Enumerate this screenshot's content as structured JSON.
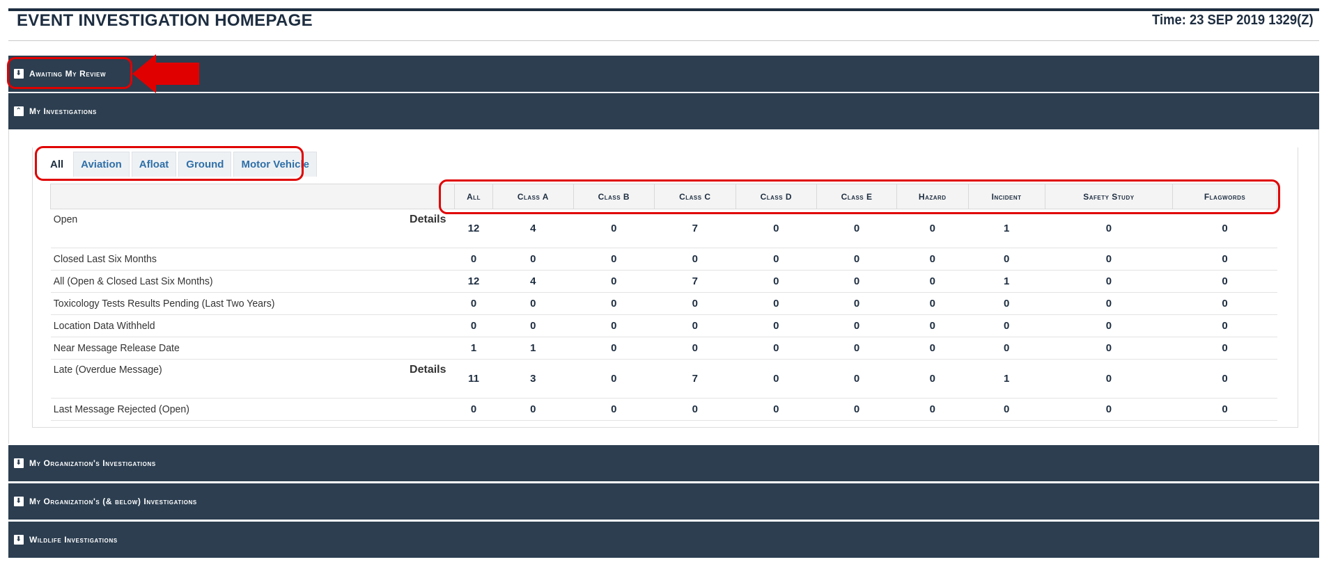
{
  "header": {
    "title": "EVENT INVESTIGATION HOMEPAGE",
    "time": "Time: 23 SEP 2019 1329(Z)"
  },
  "sections": {
    "awaiting_review": {
      "label": "Awaiting My Review",
      "icon": "down-arrow-icon",
      "toggle": "⬇"
    },
    "my_investigations": {
      "label": "My Investigations",
      "icon": "up-caret-icon",
      "toggle": "⌃"
    },
    "org_investigations": {
      "label": "My Organization's Investigations",
      "icon": "down-arrow-icon",
      "toggle": "⬇"
    },
    "org_below_investigations": {
      "label": "My Organization's (& below) Investigations",
      "icon": "down-arrow-icon",
      "toggle": "⬇"
    },
    "wildlife_investigations": {
      "label": "Wildlife Investigations",
      "icon": "down-arrow-icon",
      "toggle": "⬇"
    }
  },
  "tabs": [
    "All",
    "Aviation",
    "Afloat",
    "Ground",
    "Motor Vehicle"
  ],
  "active_tab": "All",
  "table": {
    "columns": [
      "All",
      "Class A",
      "Class B",
      "Class C",
      "Class D",
      "Class E",
      "Hazard",
      "Incident",
      "Safety Study",
      "Flagwords"
    ],
    "rows": [
      {
        "label": "Open",
        "details": "Details",
        "values": [
          "12",
          "4",
          "0",
          "7",
          "0",
          "0",
          "0",
          "1",
          "0",
          "0"
        ]
      },
      {
        "label": "Closed Last Six Months",
        "details": "",
        "values": [
          "0",
          "0",
          "0",
          "0",
          "0",
          "0",
          "0",
          "0",
          "0",
          "0"
        ]
      },
      {
        "label": "All (Open & Closed Last Six Months)",
        "details": "",
        "values": [
          "12",
          "4",
          "0",
          "7",
          "0",
          "0",
          "0",
          "1",
          "0",
          "0"
        ]
      },
      {
        "label": "Toxicology Tests Results Pending (Last Two Years)",
        "details": "",
        "values": [
          "0",
          "0",
          "0",
          "0",
          "0",
          "0",
          "0",
          "0",
          "0",
          "0"
        ]
      },
      {
        "label": "Location Data Withheld",
        "details": "",
        "values": [
          "0",
          "0",
          "0",
          "0",
          "0",
          "0",
          "0",
          "0",
          "0",
          "0"
        ]
      },
      {
        "label": "Near Message Release Date",
        "details": "",
        "values": [
          "1",
          "1",
          "0",
          "0",
          "0",
          "0",
          "0",
          "0",
          "0",
          "0"
        ]
      },
      {
        "label": "Late (Overdue Message)",
        "details": "Details",
        "values": [
          "11",
          "3",
          "0",
          "7",
          "0",
          "0",
          "0",
          "1",
          "0",
          "0"
        ]
      },
      {
        "label": "Last Message Rejected (Open)",
        "details": "",
        "values": [
          "0",
          "0",
          "0",
          "0",
          "0",
          "0",
          "0",
          "0",
          "0",
          "0"
        ]
      }
    ]
  },
  "colors": {
    "bar": "#2c3e50",
    "highlight": "#e00000",
    "tab_text": "#2f6fa8"
  }
}
